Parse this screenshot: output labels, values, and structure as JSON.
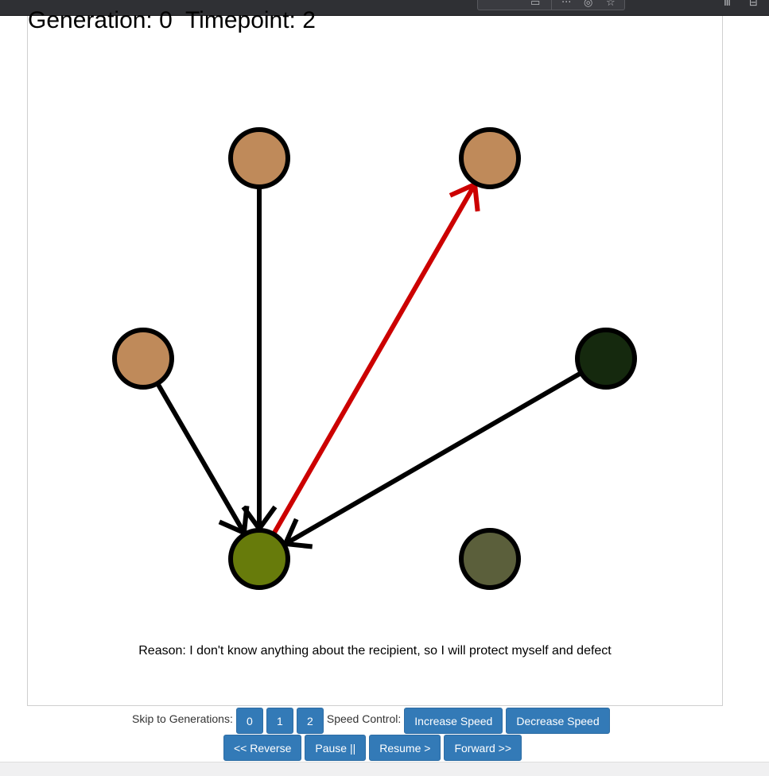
{
  "browser": {
    "icons": [
      "page-icon",
      "more-icon",
      "reader-icon",
      "bookmark-star-icon",
      "library-icon",
      "sidebar-icon"
    ]
  },
  "header": {
    "generation_label": "Generation:",
    "generation_value": "0",
    "timepoint_label": "Timepoint:",
    "timepoint_value": "2"
  },
  "network": {
    "nodes": [
      {
        "id": "n1",
        "color": "#bf8a5a"
      },
      {
        "id": "n2",
        "color": "#bf8a5a"
      },
      {
        "id": "n3",
        "color": "#bf8a5a"
      },
      {
        "id": "n4",
        "color": "#15290e"
      },
      {
        "id": "n5",
        "color": "#677b0b"
      },
      {
        "id": "n6",
        "color": "#5b5f3b"
      }
    ],
    "edges": [
      {
        "from": "n1",
        "to": "n5",
        "color": "#000000"
      },
      {
        "from": "n3",
        "to": "n5",
        "color": "#000000"
      },
      {
        "from": "n4",
        "to": "n5",
        "color": "#000000"
      },
      {
        "from": "n5",
        "to": "n2",
        "color": "#cc0000"
      }
    ]
  },
  "reason": "Reason: I don't know anything about the recipient, so I will protect myself and defect",
  "controls": {
    "skip_label": "Skip to Generations:",
    "generations": [
      "0",
      "1",
      "2"
    ],
    "speed_label": "Speed Control:",
    "increase_speed": "Increase Speed",
    "decrease_speed": "Decrease Speed",
    "reverse": "<< Reverse",
    "pause": "Pause ||",
    "resume": "Resume >",
    "forward": "Forward >>"
  },
  "colors": {
    "button_bg": "#337ab7",
    "edge_default": "#000000",
    "edge_defect": "#cc0000"
  }
}
